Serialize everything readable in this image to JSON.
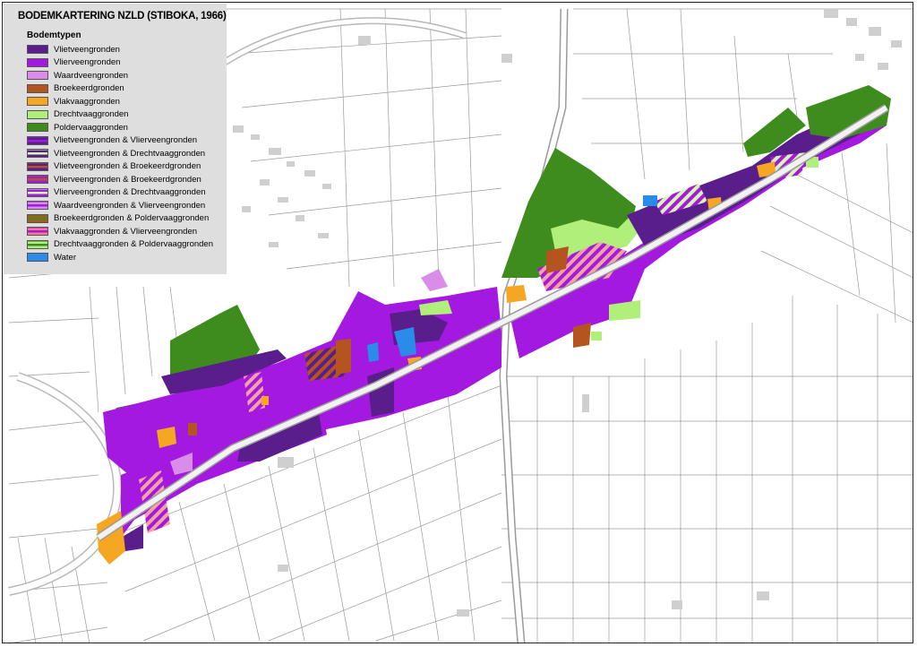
{
  "legend": {
    "title": "BODEMKARTERING NZLD (STIBOKA, 1966)",
    "subtitle": "Bodemtypen",
    "items": [
      {
        "label": "Vlietveengronden",
        "c1": "#5a1e8c"
      },
      {
        "label": "Vlierveengronden",
        "c1": "#a319e0"
      },
      {
        "label": "Waardveengronden",
        "c1": "#d98ce8"
      },
      {
        "label": "Broekeerdgronden",
        "c1": "#b4541e"
      },
      {
        "label": "Vlakvaaggronden",
        "c1": "#f5a623"
      },
      {
        "label": "Drechtvaaggronden",
        "c1": "#b0f07a"
      },
      {
        "label": "Poldervaaggronden",
        "c1": "#3f8c1e"
      },
      {
        "label": "Vlietveengronden & Vlierveengronden",
        "c1": "#5a1e8c",
        "c2": "#a319e0"
      },
      {
        "label": "Vlietveengronden & Drechtvaaggronden",
        "c1": "#5a1e8c",
        "c2": "#d8f5b0"
      },
      {
        "label": "Vlietveengronden & Broekeerdgronden",
        "c1": "#5a1e8c",
        "c2": "#b4541e"
      },
      {
        "label": "Vlierveengronden & Broekeerdgronden",
        "c1": "#a319e0",
        "c2": "#b4541e"
      },
      {
        "label": "Vlierveengronden & Drechtvaaggronden",
        "c1": "#a319e0",
        "c2": "#d8f5b0"
      },
      {
        "label": "Waardveengronden & Vlierveengronden",
        "c1": "#d98ce8",
        "c2": "#a319e0"
      },
      {
        "label": "Broekeerdgronden & Poldervaaggronden",
        "c1": "#b4541e",
        "c2": "#3f8c1e"
      },
      {
        "label": "Vlakvaaggronden & Vlierveengronden",
        "c1": "#f57a8a",
        "c2": "#a319e0"
      },
      {
        "label": "Drechtvaaggronden & Poldervaaggronden",
        "c1": "#b0f07a",
        "c2": "#3f8c1e"
      },
      {
        "label": "Water",
        "c1": "#2a8be8"
      }
    ]
  }
}
